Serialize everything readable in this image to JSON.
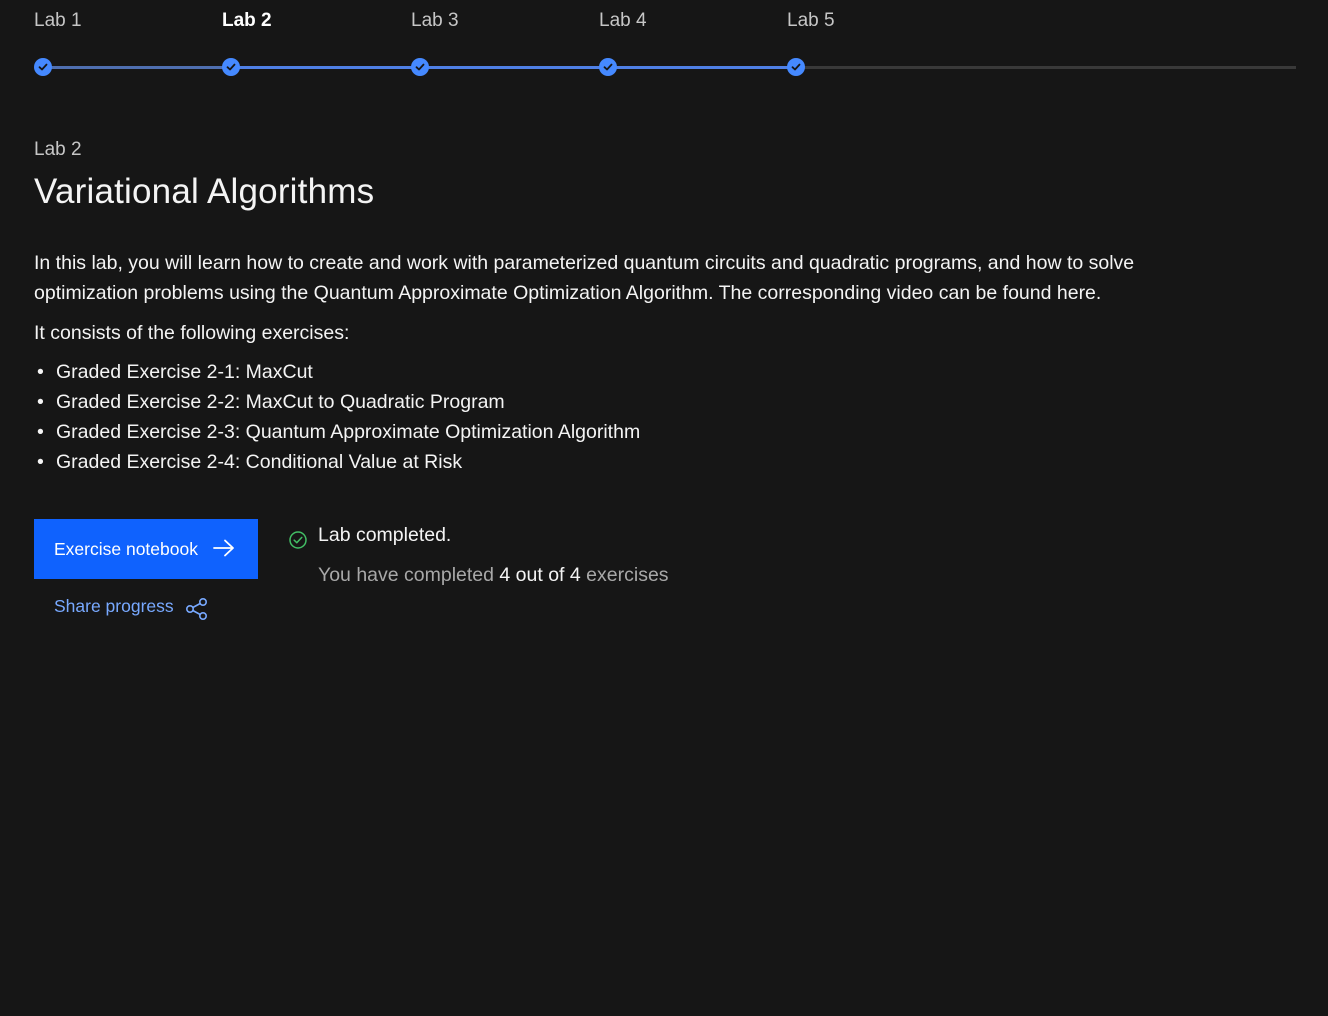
{
  "progress": {
    "steps": [
      {
        "label": "Lab 1",
        "status": "complete",
        "active": false
      },
      {
        "label": "Lab 2",
        "status": "complete",
        "active": true
      },
      {
        "label": "Lab 3",
        "status": "complete",
        "active": false
      },
      {
        "label": "Lab 4",
        "status": "complete",
        "active": false
      },
      {
        "label": "Lab 5",
        "status": "complete",
        "active": false
      }
    ],
    "accent_color": "#4589ff"
  },
  "lab": {
    "eyebrow": "Lab 2",
    "title": "Variational Algorithms",
    "description": "In this lab, you will learn how to create and work with parameterized quantum circuits and quadratic programs, and how to solve optimization problems using the Quantum Approximate Optimization Algorithm. The corresponding video can be found here.",
    "consists_label": "It consists of the following exercises:",
    "exercises": [
      "Graded Exercise 2-1: MaxCut",
      "Graded Exercise 2-2: MaxCut to Quadratic Program",
      "Graded Exercise 2-3: Quantum Approximate Optimization Algorithm",
      "Graded Exercise 2-4: Conditional Value at Risk"
    ]
  },
  "actions": {
    "notebook_label": "Exercise notebook",
    "share_label": "Share progress",
    "button_color": "#0f62fe",
    "link_color": "#78a9ff"
  },
  "status": {
    "title": "Lab completed.",
    "detail_prefix": "You have completed",
    "detail_count": "4 out of 4",
    "detail_suffix": "exercises",
    "success_color": "#42be65"
  }
}
